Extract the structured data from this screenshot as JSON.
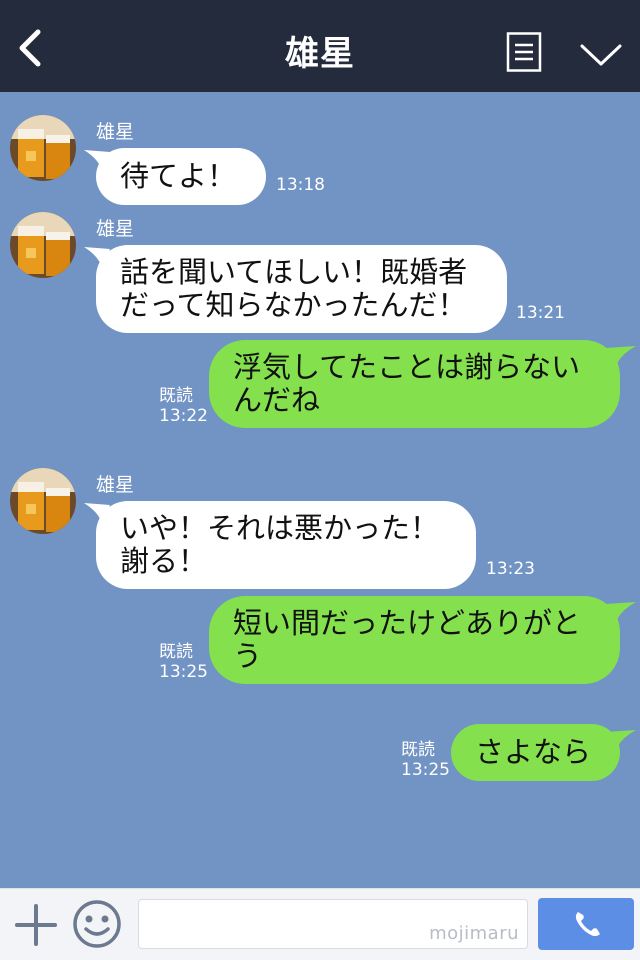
{
  "header": {
    "title": "雄星",
    "back_icon": "chevron-left-icon",
    "menu_icon": "menu-list-icon",
    "collapse_icon": "chevron-down-icon"
  },
  "messages": [
    {
      "side": "left",
      "sender": "雄星",
      "text": "待てよ！",
      "time": "13:18"
    },
    {
      "side": "left",
      "sender": "雄星",
      "text": "話を聞いてほしい！既婚者\nだって知らなかったんだ！",
      "time": "13:21"
    },
    {
      "side": "right",
      "read": "既読",
      "text": "浮気してたことは謝らない\nんだね",
      "time": "13:22"
    },
    {
      "side": "left",
      "sender": "雄星",
      "text": "いや！それは悪かった！\n謝る！",
      "time": "13:23"
    },
    {
      "side": "right",
      "read": "既読",
      "text": "短い間だったけどありがと\nう",
      "time": "13:25"
    },
    {
      "side": "right",
      "read": "既読",
      "text": "さよなら",
      "time": "13:25"
    }
  ],
  "input_bar": {
    "watermark": "mojimaru",
    "plus_icon": "plus-icon",
    "emoji_icon": "smiley-icon",
    "call_icon": "phone-icon"
  },
  "colors": {
    "header_bg": "#232b3c",
    "chat_bg": "#7294c4",
    "bubble_left": "#ffffff",
    "bubble_right": "#84e04d",
    "call_button": "#5d8ee5"
  }
}
